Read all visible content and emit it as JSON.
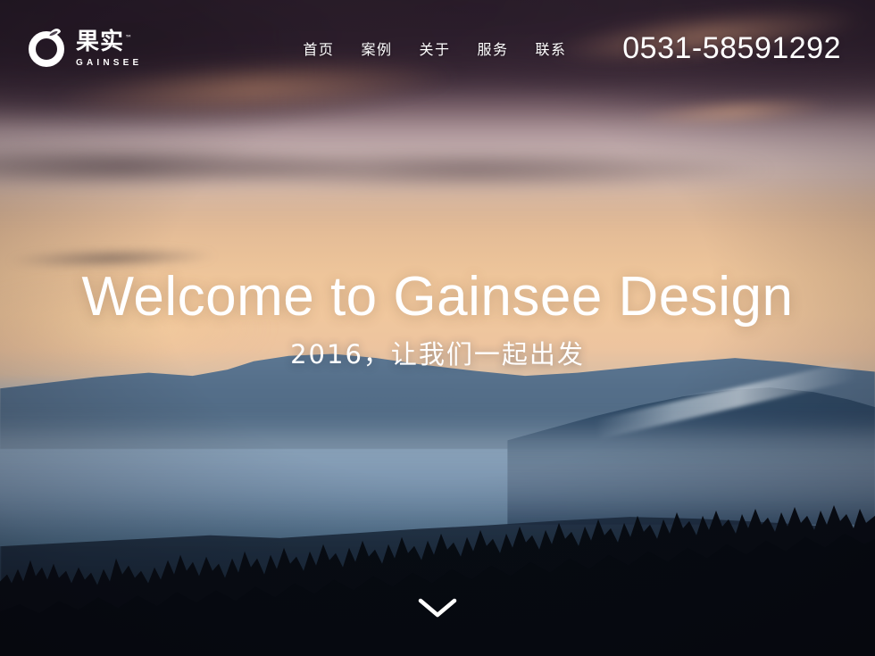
{
  "site": {
    "brand": {
      "logo_icon": "gainsee-fruit-ring-icon",
      "name_cn": "果实",
      "trademark": "™",
      "name_en": "GAINSEE"
    },
    "nav": {
      "items": [
        {
          "label": "首页"
        },
        {
          "label": "案例"
        },
        {
          "label": "关于"
        },
        {
          "label": "服务"
        },
        {
          "label": "联系"
        }
      ]
    },
    "phone": "0531-58591292"
  },
  "hero": {
    "title": "Welcome to Gainsee Design",
    "subtitle": "2016，让我们一起出发",
    "scroll_icon": "chevron-down-icon"
  },
  "colors": {
    "text": "#ffffff",
    "sky_top": "#3a2b3c",
    "sky_warm": "#f0c79d",
    "mountain_blue": "#3f5b78",
    "treeline": "#080d14"
  }
}
